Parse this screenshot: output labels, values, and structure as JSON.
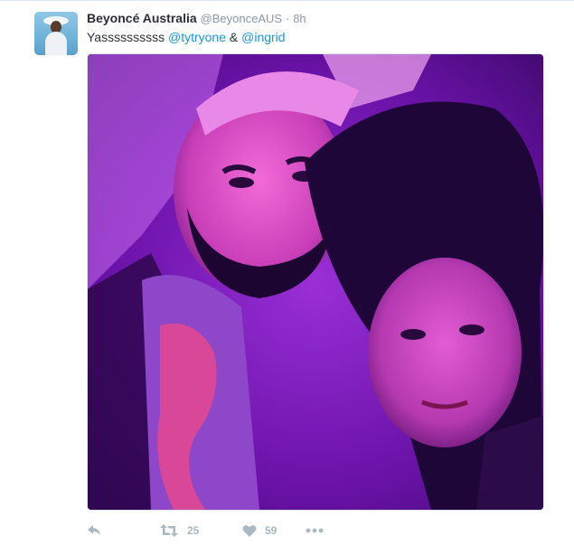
{
  "tweet": {
    "author": {
      "name": "Beyoncé Australia",
      "handle": "@BeyonceAUS",
      "separator": "·",
      "time": "8h"
    },
    "text": {
      "lead": "Yassssssssss",
      "mention1": "@tytryone",
      "joiner": "&",
      "mention2": "@ingrid"
    },
    "media": {
      "description_icon": "photo-two-people-selfie"
    },
    "actions": {
      "reply_icon": "reply-icon",
      "retweet_count": "25",
      "like_count": "59",
      "more_icon": "ellipsis-icon"
    }
  },
  "colors": {
    "name": "#292f33",
    "meta": "#8899a6",
    "link": "#1b95e0",
    "action": "#aab8c2",
    "photo_dominant": "#7a1fb8"
  }
}
